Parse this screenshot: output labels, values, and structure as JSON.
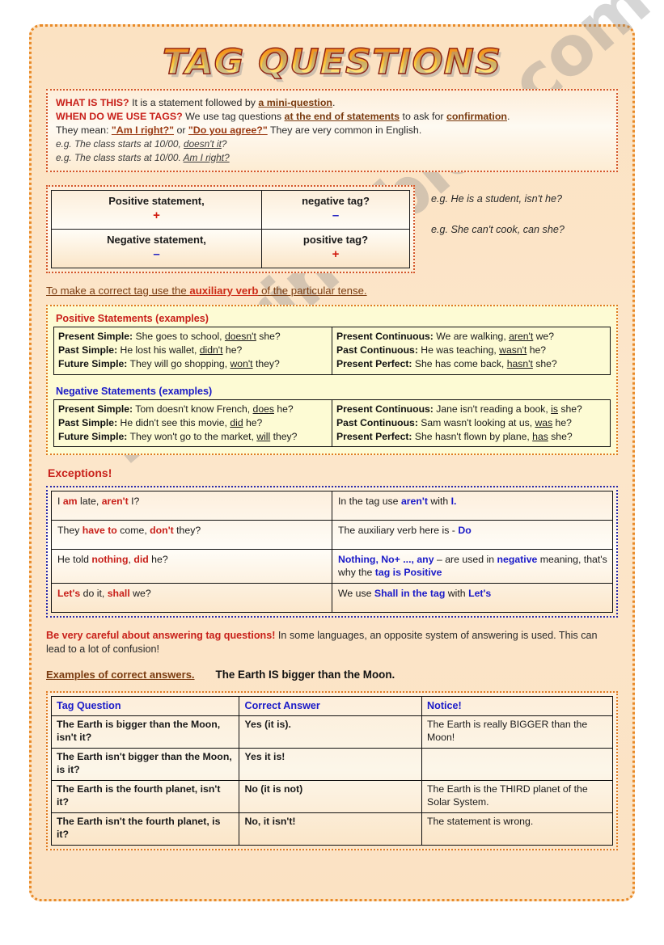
{
  "title": "TAG QUESTIONS",
  "watermark": "ESLprintables.com",
  "intro": {
    "line1_head": "WHAT IS THIS?",
    "line1_a": " It is a statement followed by ",
    "line1_hl": "a mini-question",
    "line1_end": ".",
    "line2_head": "WHEN DO WE USE TAGS?",
    "line2_a": " We use tag questions ",
    "line2_hl1": "at the end of statements",
    "line2_b": " to ask for ",
    "line2_hl2": "confirmation",
    "line2_end": ".",
    "line3_a": "They mean: ",
    "line3_hl1": "\"Am I right?\"",
    "line3_b": " or ",
    "line3_hl2": "\"Do you agree?\"",
    "line3_end": " They are very common in English.",
    "eg1_a": "e.g. The class starts at 10/00, ",
    "eg1_u": "doesn't it",
    "eg1_end": "?",
    "eg2_a": "e.g. The class starts at 10/00. ",
    "eg2_u": "Am I right?"
  },
  "structure": {
    "rows": [
      {
        "statement": "Positive statement,",
        "statement_sym": "+",
        "statement_sym_kind": "plus",
        "tag": "negative tag?",
        "tag_sym": "–",
        "tag_sym_kind": "minus"
      },
      {
        "statement": "Negative statement,",
        "statement_sym": "–",
        "statement_sym_kind": "minus",
        "tag": "positive tag?",
        "tag_sym": "+",
        "tag_sym_kind": "plus"
      }
    ],
    "examples": [
      "e.g.  He is a student, isn't he?",
      "e.g.  She can't cook, can she?"
    ]
  },
  "rule": {
    "a": "To make a correct tag use the ",
    "aux": "auxiliary verb",
    "b": " of the particular tense."
  },
  "positive": {
    "heading": "Positive Statements (examples)",
    "left": [
      {
        "tense": "Present Simple:",
        "text_a": " She goes to school, ",
        "tag": "doesn't",
        "text_b": " she?"
      },
      {
        "tense": "Past Simple:",
        "text_a": " He lost his wallet, ",
        "tag": "didn't",
        "text_b": " he?"
      },
      {
        "tense": "Future Simple:",
        "text_a": " They will go shopping, ",
        "tag": "won't",
        "text_b": " they?"
      }
    ],
    "right": [
      {
        "tense": "Present Continuous:",
        "text_a": " We are walking, ",
        "tag": "aren't",
        "text_b": " we?"
      },
      {
        "tense": "Past Continuous:",
        "text_a": " He was teaching, ",
        "tag": "wasn't",
        "text_b": " he?"
      },
      {
        "tense": "Present Perfect:",
        "text_a": " She has come back, ",
        "tag": "hasn't",
        "text_b": " she?"
      }
    ]
  },
  "negative": {
    "heading": "Negative Statements (examples)",
    "left": [
      {
        "tense": "Present Simple:",
        "text_a": " Tom doesn't know French, ",
        "tag": "does",
        "text_b": " he?"
      },
      {
        "tense": "Past Simple:",
        "text_a": " He didn't see this movie, ",
        "tag": "did",
        "text_b": " he?"
      },
      {
        "tense": "Future Simple:",
        "text_a": " They won't go to the market, ",
        "tag": "will",
        "text_b": " they?"
      }
    ],
    "right": [
      {
        "tense": "Present Continuous:",
        "text_a": " Jane isn't reading a book, ",
        "tag": "is",
        "text_b": " she?"
      },
      {
        "tense": "Past Continuous:",
        "text_a": " Sam wasn't looking at us, ",
        "tag": "was",
        "text_b": " he?"
      },
      {
        "tense": "Present Perfect:",
        "text_a": " She hasn't flown by plane, ",
        "tag": "has",
        "text_b": " she?"
      }
    ]
  },
  "exceptions": {
    "title": "Exceptions!",
    "rows": [
      {
        "left": [
          {
            "t": "I ",
            "s": "plain"
          },
          {
            "t": "am",
            "s": "red"
          },
          {
            "t": " late, ",
            "s": "plain"
          },
          {
            "t": "aren't",
            "s": "red"
          },
          {
            "t": " I?",
            "s": "plain"
          }
        ],
        "right": [
          {
            "t": "In the tag use ",
            "s": "plain"
          },
          {
            "t": "aren't",
            "s": "blue"
          },
          {
            "t": " with ",
            "s": "plain"
          },
          {
            "t": "I.",
            "s": "blue"
          }
        ]
      },
      {
        "left": [
          {
            "t": "They ",
            "s": "plain"
          },
          {
            "t": "have to",
            "s": "red"
          },
          {
            "t": " come, ",
            "s": "plain"
          },
          {
            "t": "don't",
            "s": "red"
          },
          {
            "t": " they?",
            "s": "plain"
          }
        ],
        "right": [
          {
            "t": "The auxiliary verb here is - ",
            "s": "plain"
          },
          {
            "t": "Do",
            "s": "blue"
          }
        ]
      },
      {
        "left": [
          {
            "t": "He told ",
            "s": "plain"
          },
          {
            "t": "nothing",
            "s": "red"
          },
          {
            "t": ", ",
            "s": "plain"
          },
          {
            "t": "did",
            "s": "red"
          },
          {
            "t": " he?",
            "s": "plain"
          }
        ],
        "right": [
          {
            "t": "Nothing, No+ ..., any",
            "s": "blue"
          },
          {
            "t": " – are used in ",
            "s": "plain"
          },
          {
            "t": "negative",
            "s": "blue"
          },
          {
            "t": " meaning, that's why the ",
            "s": "plain"
          },
          {
            "t": "tag is Positive",
            "s": "blue"
          }
        ]
      },
      {
        "left": [
          {
            "t": "Let's",
            "s": "red"
          },
          {
            "t": " do it, ",
            "s": "plain"
          },
          {
            "t": "shall",
            "s": "red"
          },
          {
            "t": " we?",
            "s": "plain"
          }
        ],
        "right": [
          {
            "t": "We use ",
            "s": "plain"
          },
          {
            "t": "Shall in the tag",
            "s": "blue"
          },
          {
            "t": " with ",
            "s": "plain"
          },
          {
            "t": "Let's",
            "s": "blue"
          }
        ]
      }
    ]
  },
  "careful": {
    "warn": "Be very careful about answering tag questions!",
    "text": " In some languages, an opposite system of answering is used. This can lead to a lot of confusion!"
  },
  "answers_intro": {
    "label": "Examples of correct answers.",
    "fact": "The Earth IS bigger than the Moon."
  },
  "answers_table": {
    "headers": [
      "Tag Question",
      "Correct Answer",
      "Notice!"
    ],
    "rows": [
      {
        "question": "The Earth is bigger than the Moon, isn't it?",
        "answer": "Yes (it is).",
        "notice": "The Earth is really BIGGER than the Moon!"
      },
      {
        "question": "The Earth isn't bigger than the Moon, is it?",
        "answer": "Yes it is!",
        "notice": ""
      },
      {
        "question": "The Earth is the fourth planet, isn't it?",
        "answer": "No (it is not)",
        "notice": "The Earth is the THIRD planet of the Solar System."
      },
      {
        "question": "The Earth isn't the fourth planet, is it?",
        "answer": "No, it isn't!",
        "notice": "The statement is wrong."
      }
    ]
  },
  "colors": {
    "page_border": "#e98a28",
    "page_bg": "#fbe3c4",
    "accent_red": "#c8201a",
    "accent_blue": "#1a1ac8",
    "accent_brown": "#7a3b10",
    "yellow_panel": "#fdfbd4"
  }
}
